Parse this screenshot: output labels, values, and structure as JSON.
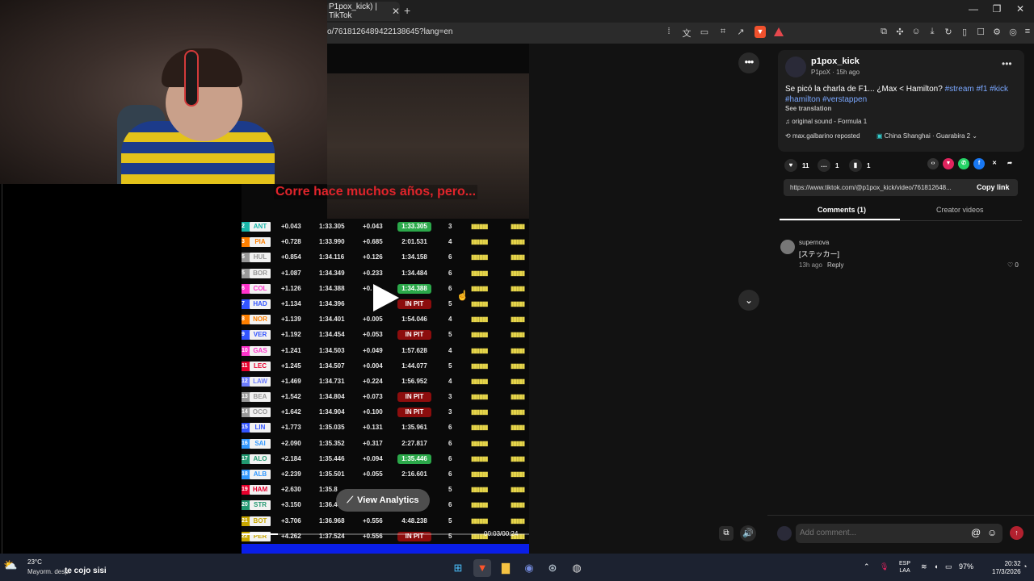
{
  "browser": {
    "tab_title": "P1pox_kick) | TikTok",
    "tab_close": "✕",
    "new_tab": "+",
    "url": "o/7618126489422138645?lang=en",
    "window_controls": [
      "—",
      "❐",
      "✕"
    ]
  },
  "tiktok": {
    "search_value": "t",
    "post": {
      "username": "p1pox_kick",
      "subline": "P1poX · 15h ago",
      "description": "Se picó la charla de F1... ¿Max < Hamilton? ",
      "hashtags_1": "#stream #f1 #kick",
      "hashtags_2": "#hamilton #verstappen",
      "see_translation": "See translation",
      "sound": "original sound - Formula 1",
      "reposted_by": "max.galbarino reposted",
      "reposted_more": "China Shanghai · Guarabira  2",
      "likes": "11",
      "comments": "1",
      "saves": "1",
      "link": "https://www.tiktok.com/@p1pox_kick/video/761812648...",
      "copy_link": "Copy link"
    },
    "tabs": {
      "comments": "Comments (1)",
      "creator_videos": "Creator videos"
    },
    "comment": {
      "name": "supernova",
      "text": "[ステッカー]",
      "time": "13h ago",
      "reply": "Reply",
      "likes": "0"
    },
    "comment_input_placeholder": "Add comment...",
    "video": {
      "subtitle": "Corre hace muchos años, pero...",
      "analytics_label": "View Analytics",
      "time": "00:03/00:24",
      "progress": 0.125
    },
    "timing_rows": [
      {
        "pos": "2",
        "code": "ANT",
        "color": "#18b6a9",
        "gap": "+0.043",
        "lap": "1:33.305",
        "int": "+0.043",
        "last": "1:33.305",
        "last_type": "best",
        "stint": "3"
      },
      {
        "pos": "3",
        "code": "PIA",
        "color": "#ff8000",
        "gap": "+0.728",
        "lap": "1:33.990",
        "int": "+0.685",
        "last": "2:01.531",
        "last_type": "",
        "stint": "4"
      },
      {
        "pos": "5",
        "code": "HUL",
        "color": "#999999",
        "gap": "+0.854",
        "lap": "1:34.116",
        "int": "+0.126",
        "last": "1:34.158",
        "last_type": "",
        "stint": "6"
      },
      {
        "pos": "5",
        "code": "BOR",
        "color": "#999999",
        "gap": "+1.087",
        "lap": "1:34.349",
        "int": "+0.233",
        "last": "1:34.484",
        "last_type": "",
        "stint": "6"
      },
      {
        "pos": "6",
        "code": "COL",
        "color": "#ff33cc",
        "gap": "+1.126",
        "lap": "1:34.388",
        "int": "+0.",
        "last": "1:34.388",
        "last_type": "best",
        "stint": "6"
      },
      {
        "pos": "7",
        "code": "HAD",
        "color": "#3355ff",
        "gap": "+1.134",
        "lap": "1:34.396",
        "int": "",
        "last": "IN PIT",
        "last_type": "pit",
        "stint": "5"
      },
      {
        "pos": "8",
        "code": "NOR",
        "color": "#ff8000",
        "gap": "+1.139",
        "lap": "1:34.401",
        "int": "+0.005",
        "last": "1:54.046",
        "last_type": "",
        "stint": "4"
      },
      {
        "pos": "9",
        "code": "VER",
        "color": "#3355ff",
        "gap": "+1.192",
        "lap": "1:34.454",
        "int": "+0.053",
        "last": "IN PIT",
        "last_type": "pit",
        "stint": "5"
      },
      {
        "pos": "10",
        "code": "GAS",
        "color": "#ff33cc",
        "gap": "+1.241",
        "lap": "1:34.503",
        "int": "+0.049",
        "last": "1:57.628",
        "last_type": "",
        "stint": "4"
      },
      {
        "pos": "11",
        "code": "LEC",
        "color": "#e8002d",
        "gap": "+1.245",
        "lap": "1:34.507",
        "int": "+0.004",
        "last": "1:44.077",
        "last_type": "",
        "stint": "5"
      },
      {
        "pos": "12",
        "code": "LAW",
        "color": "#6c7cff",
        "gap": "+1.469",
        "lap": "1:34.731",
        "int": "+0.224",
        "last": "1:56.952",
        "last_type": "",
        "stint": "4"
      },
      {
        "pos": "13",
        "code": "BEA",
        "color": "#999999",
        "gap": "+1.542",
        "lap": "1:34.804",
        "int": "+0.073",
        "last": "IN PIT",
        "last_type": "pit",
        "stint": "3"
      },
      {
        "pos": "14",
        "code": "OCO",
        "color": "#999999",
        "gap": "+1.642",
        "lap": "1:34.904",
        "int": "+0.100",
        "last": "IN PIT",
        "last_type": "pit",
        "stint": "3"
      },
      {
        "pos": "15",
        "code": "LIN",
        "color": "#3355ff",
        "gap": "+1.773",
        "lap": "1:35.035",
        "int": "+0.131",
        "last": "1:35.961",
        "last_type": "",
        "stint": "6"
      },
      {
        "pos": "16",
        "code": "SAI",
        "color": "#3399ff",
        "gap": "+2.090",
        "lap": "1:35.352",
        "int": "+0.317",
        "last": "2:27.817",
        "last_type": "",
        "stint": "6"
      },
      {
        "pos": "17",
        "code": "ALO",
        "color": "#229971",
        "gap": "+2.184",
        "lap": "1:35.446",
        "int": "+0.094",
        "last": "1:35.446",
        "last_type": "best",
        "stint": "6"
      },
      {
        "pos": "18",
        "code": "ALB",
        "color": "#3399ff",
        "gap": "+2.239",
        "lap": "1:35.501",
        "int": "+0.055",
        "last": "2:16.601",
        "last_type": "",
        "stint": "6"
      },
      {
        "pos": "19",
        "code": "HAM",
        "color": "#e8002d",
        "gap": "+2.630",
        "lap": "1:35.8",
        "int": "",
        "last": "",
        "last_type": "",
        "stint": "5"
      },
      {
        "pos": "20",
        "code": "STR",
        "color": "#229971",
        "gap": "+3.150",
        "lap": "1:36.4",
        "int": "",
        "last": "",
        "last_type": "",
        "stint": "6"
      },
      {
        "pos": "21",
        "code": "BOT",
        "color": "#c9a800",
        "gap": "+3.706",
        "lap": "1:36.968",
        "int": "+0.556",
        "last": "4:48.238",
        "last_type": "",
        "stint": "5"
      },
      {
        "pos": "22",
        "code": "PER",
        "color": "#c9a800",
        "gap": "+4.262",
        "lap": "1:37.524",
        "int": "+0.556",
        "last": "IN PIT",
        "last_type": "pit",
        "stint": "5"
      }
    ]
  },
  "taskbar": {
    "weather_temp": "23°C",
    "weather_desc": "Mayorm. desp.",
    "ticker": "te cojo sisi",
    "lang_1": "ESP",
    "lang_2": "LAA",
    "battery": "97%",
    "time": "20:32",
    "date": "17/3/2026"
  }
}
